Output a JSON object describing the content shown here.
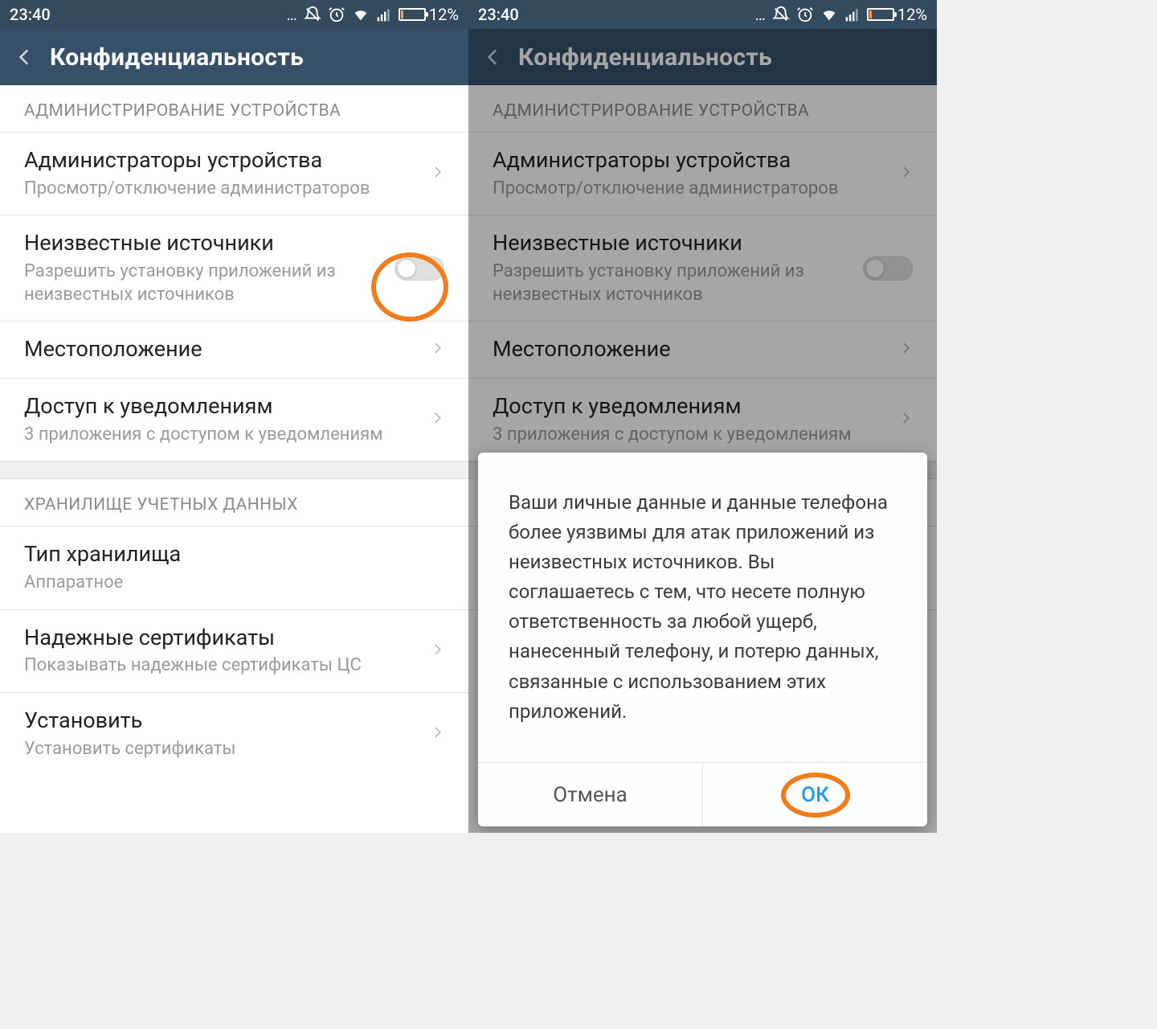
{
  "status": {
    "time": "23:40",
    "battery_pct": "12%"
  },
  "appbar": {
    "title": "Конфиденциальность"
  },
  "sections": {
    "admin": {
      "header": "АДМИНИСТРИРОВАНИЕ УСТРОЙСТВА",
      "device_admins": {
        "title": "Администраторы устройства",
        "sub": "Просмотр/отключение администраторов"
      },
      "unknown_sources": {
        "title": "Неизвестные источники",
        "sub": "Разрешить установку приложений из неизвестных источников"
      },
      "location": {
        "title": "Местоположение"
      },
      "notif_access": {
        "title": "Доступ к уведомлениям",
        "sub": "3 приложения с доступом к уведомлениям"
      }
    },
    "storage": {
      "header": "ХРАНИЛИЩЕ УЧЕТНЫХ ДАННЫХ",
      "type": {
        "title": "Тип хранилища",
        "sub": "Аппаратное"
      },
      "trusted": {
        "title": "Надежные сертификаты",
        "sub": "Показывать надежные сертификаты ЦС"
      },
      "install": {
        "title": "Установить",
        "sub": "Установить сертификаты"
      }
    }
  },
  "dialog": {
    "text": "Ваши личные данные и данные телефона более уязвимы для атак приложений из неизвестных источников. Вы соглашаетесь с тем, что несете полную ответственность за любой ущерб, нанесенный телефону, и потерю данных, связанные с использованием этих приложений.",
    "cancel": "Отмена",
    "ok": "ОК"
  }
}
